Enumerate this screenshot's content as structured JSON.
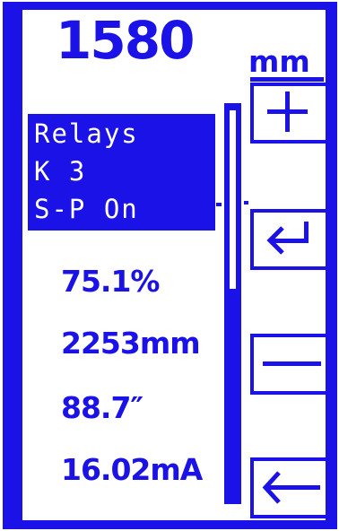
{
  "display": {
    "main_value": "1580",
    "main_unit": "mm"
  },
  "relays": {
    "line1": "Relays",
    "line2": "K 3",
    "line3": "S-P On"
  },
  "readings": [
    "75.1%",
    "2253mm",
    "88.7″",
    "16.02mA"
  ],
  "buttons": {
    "plus": "plus-icon",
    "enter": "enter-arrow-icon",
    "minus": "minus-icon",
    "back": "left-arrow-icon"
  },
  "colors": {
    "accent": "#1a12e6",
    "background": "#ffffff"
  }
}
